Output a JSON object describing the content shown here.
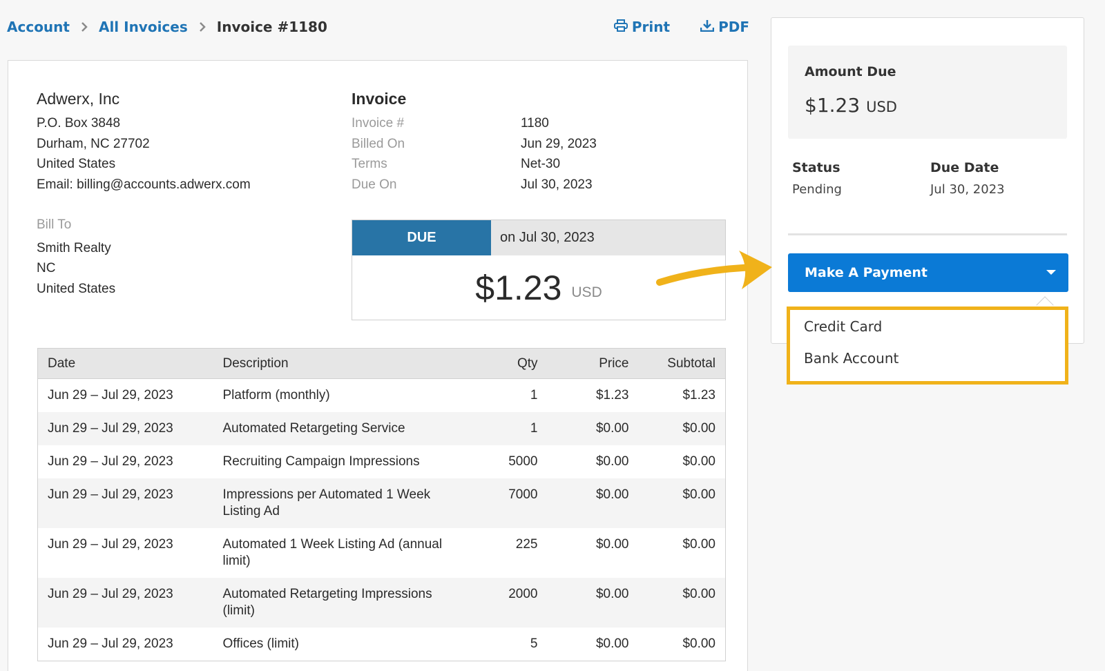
{
  "breadcrumb": {
    "account": "Account",
    "all_invoices": "All Invoices",
    "current": "Invoice #1180"
  },
  "actions": {
    "print": "Print",
    "pdf": "PDF"
  },
  "company": {
    "name": "Adwerx, Inc",
    "lines": [
      "P.O. Box 3848",
      "Durham, NC 27702",
      "United States",
      "Email: billing@accounts.adwerx.com"
    ]
  },
  "bill_to": {
    "label": "Bill To",
    "lines": [
      "Smith Realty",
      "NC",
      "United States"
    ]
  },
  "invoice": {
    "heading": "Invoice",
    "rows": [
      {
        "key": "Invoice #",
        "value": "1180"
      },
      {
        "key": "Billed On",
        "value": "Jun 29, 2023"
      },
      {
        "key": "Terms",
        "value": "Net-30"
      },
      {
        "key": "Due On",
        "value": "Jul 30, 2023"
      }
    ]
  },
  "due": {
    "tag": "DUE",
    "on": "on Jul 30, 2023",
    "amount": "$1.23",
    "currency": "USD"
  },
  "table": {
    "headers": [
      "Date",
      "Description",
      "Qty",
      "Price",
      "Subtotal"
    ],
    "rows": [
      [
        "Jun 29 – Jul 29, 2023",
        "Platform (monthly)",
        "1",
        "$1.23",
        "$1.23"
      ],
      [
        "Jun 29 – Jul 29, 2023",
        "Automated Retargeting Service",
        "1",
        "$0.00",
        "$0.00"
      ],
      [
        "Jun 29 – Jul 29, 2023",
        "Recruiting Campaign Impressions",
        "5000",
        "$0.00",
        "$0.00"
      ],
      [
        "Jun 29 – Jul 29, 2023",
        "Impressions per Automated 1 Week Listing Ad",
        "7000",
        "$0.00",
        "$0.00"
      ],
      [
        "Jun 29 – Jul 29, 2023",
        "Automated 1 Week Listing Ad (annual limit)",
        "225",
        "$0.00",
        "$0.00"
      ],
      [
        "Jun 29 – Jul 29, 2023",
        "Automated Retargeting Impressions (limit)",
        "2000",
        "$0.00",
        "$0.00"
      ],
      [
        "Jun 29 – Jul 29, 2023",
        "Offices (limit)",
        "5",
        "$0.00",
        "$0.00"
      ]
    ]
  },
  "side": {
    "amount_label": "Amount Due",
    "amount_value": "$1.23",
    "amount_currency": "USD",
    "status_label": "Status",
    "status_value": "Pending",
    "due_date_label": "Due Date",
    "due_date_value": "Jul 30, 2023",
    "pay_button": "Make A Payment",
    "options": [
      "Credit Card",
      "Bank Account"
    ]
  },
  "colors": {
    "link": "#1f74b5",
    "due_tag": "#2874a6",
    "button": "#0b7ad6",
    "highlight": "#f0b21a"
  }
}
